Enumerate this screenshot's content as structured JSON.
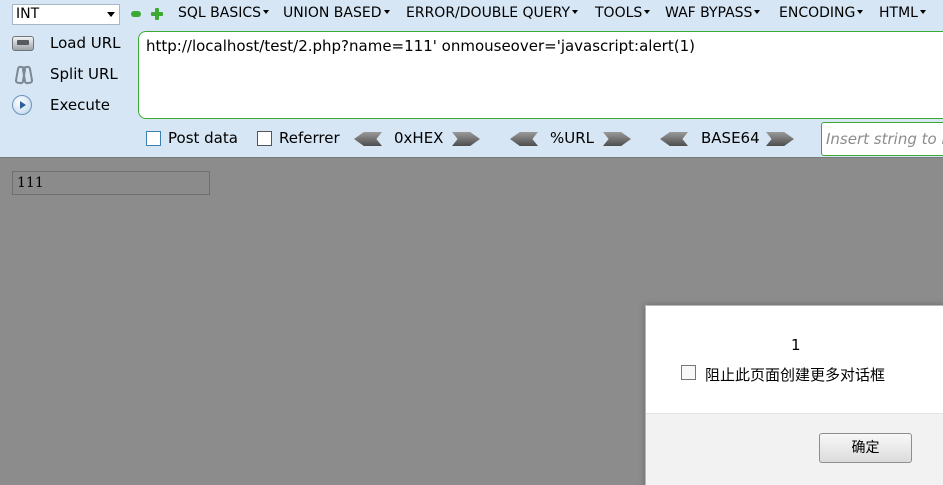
{
  "hackbar": {
    "type_select": "INT",
    "menus": [
      {
        "label": "SQL BASICS"
      },
      {
        "label": "UNION BASED"
      },
      {
        "label": "ERROR/DOUBLE QUERY"
      },
      {
        "label": "TOOLS"
      },
      {
        "label": "WAF BYPASS"
      },
      {
        "label": "ENCODING"
      },
      {
        "label": "HTML"
      }
    ],
    "actions": {
      "load_url": "Load URL",
      "split_url": "Split URL",
      "execute": "Execute"
    },
    "url": "http://localhost/test/2.php?name=111' onmouseover='javascript:alert(1)",
    "options": {
      "post_data": "Post data",
      "referrer": "Referrer"
    },
    "converters": {
      "hex": "0xHEX",
      "url": "%URL",
      "base64": "BASE64"
    },
    "insert_placeholder": "Insert string to r"
  },
  "page": {
    "input_value": "111"
  },
  "dialog": {
    "message": "1",
    "checkbox_label": "阻止此页面创建更多对话框",
    "ok_label": "确定"
  },
  "colors": {
    "toolbar_bg": "#d6e6f5",
    "accent_green": "#3da935",
    "page_overlay": "#8c8c8c"
  }
}
